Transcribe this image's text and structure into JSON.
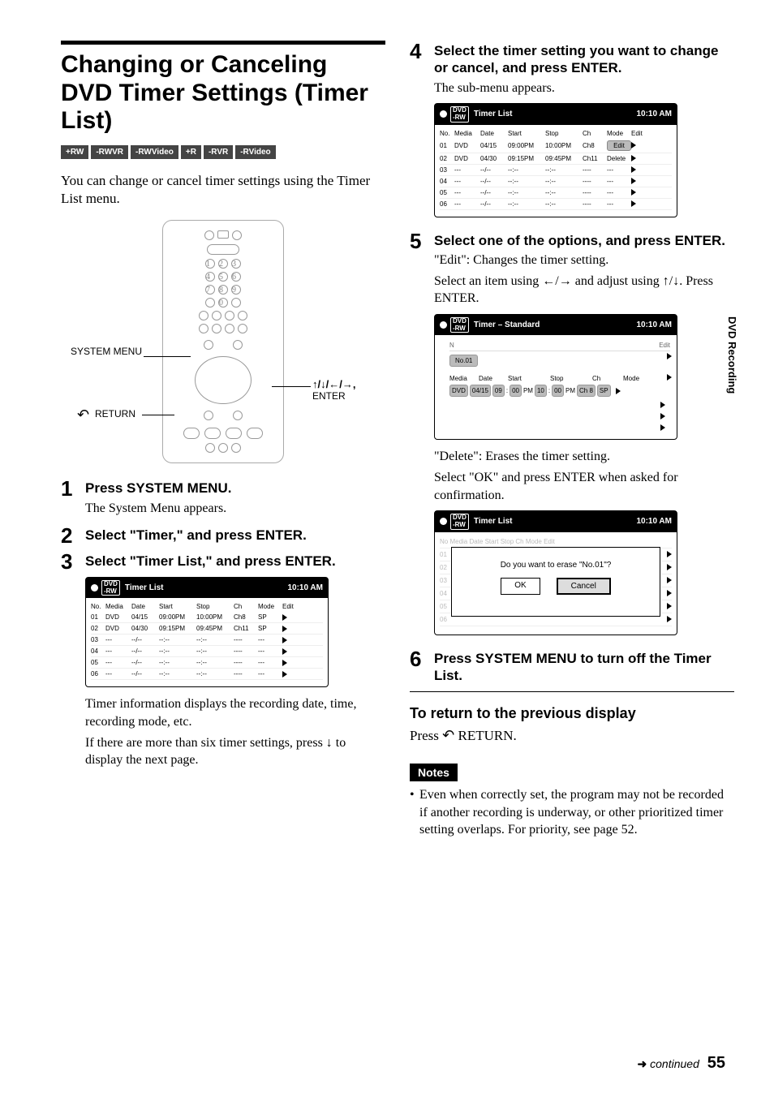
{
  "page_number": "55",
  "continued": "continued",
  "side_tab": "DVD Recording",
  "title": "Changing or Canceling DVD Timer Settings (Timer List)",
  "badges": [
    "+RW",
    "-RWVR",
    "-RWVideo",
    "+R",
    "-RVR",
    "-RVideo"
  ],
  "intro": "You can change or cancel timer settings using the Timer List menu.",
  "remote_labels": {
    "system_menu": "SYSTEM MENU",
    "return": "RETURN",
    "arrows_enter": "↑/↓/←/→, ENTER"
  },
  "steps_left": [
    {
      "num": "1",
      "head": "Press SYSTEM MENU.",
      "sub": "The System Menu appears."
    },
    {
      "num": "2",
      "head": "Select \"Timer,\" and press ENTER."
    },
    {
      "num": "3",
      "head": "Select \"Timer List,\" and press ENTER."
    }
  ],
  "after_screen_left": [
    "Timer information displays the recording date, time, recording mode, etc.",
    "If there are more than six timer settings, press ↓ to display the next page."
  ],
  "screenA": {
    "title": "Timer List",
    "time": "10:10 AM",
    "headers": [
      "No.",
      "Media",
      "Date",
      "Start",
      "Stop",
      "Ch",
      "Mode",
      "Edit"
    ],
    "rows": [
      [
        "01",
        "DVD",
        "04/15",
        "09:00PM",
        "10:00PM",
        "Ch8",
        "SP"
      ],
      [
        "02",
        "DVD",
        "04/30",
        "09:15PM",
        "09:45PM",
        "Ch11",
        "SP"
      ],
      [
        "03",
        "---",
        "--/--",
        "--:--",
        "--:--",
        "----",
        "---"
      ],
      [
        "04",
        "---",
        "--/--",
        "--:--",
        "--:--",
        "----",
        "---"
      ],
      [
        "05",
        "---",
        "--/--",
        "--:--",
        "--:--",
        "----",
        "---"
      ],
      [
        "06",
        "---",
        "--/--",
        "--:--",
        "--:--",
        "----",
        "---"
      ]
    ]
  },
  "steps_right": [
    {
      "num": "4",
      "head": "Select the timer setting you want to change or cancel, and press ENTER.",
      "sub": "The sub-menu appears."
    },
    {
      "num": "5",
      "head": "Select one of the options, and press ENTER.",
      "lines": [
        "\"Edit\": Changes the timer setting.",
        "Select an item using ←/→ and adjust using ↑/↓. Press ENTER."
      ],
      "lines2": [
        "\"Delete\": Erases the timer setting.",
        "Select \"OK\" and press ENTER when asked for confirmation."
      ]
    },
    {
      "num": "6",
      "head": "Press SYSTEM MENU to turn off the Timer List."
    }
  ],
  "screenB": {
    "title": "Timer List",
    "time": "10:10 AM",
    "headers": [
      "No.",
      "Media",
      "Date",
      "Start",
      "Stop",
      "Ch",
      "Mode",
      "Edit"
    ],
    "rows": [
      [
        "01",
        "DVD",
        "04/15",
        "09:00PM",
        "10:00PM",
        "Ch8",
        "Edit"
      ],
      [
        "02",
        "DVD",
        "04/30",
        "09:15PM",
        "09:45PM",
        "Ch11",
        "Delete"
      ],
      [
        "03",
        "---",
        "--/--",
        "--:--",
        "--:--",
        "----",
        "---"
      ],
      [
        "04",
        "---",
        "--/--",
        "--:--",
        "--:--",
        "----",
        "---"
      ],
      [
        "05",
        "---",
        "--/--",
        "--:--",
        "--:--",
        "----",
        "---"
      ],
      [
        "06",
        "---",
        "--/--",
        "--:--",
        "--:--",
        "----",
        "---"
      ]
    ]
  },
  "screenC": {
    "title": "Timer – Standard",
    "time": "10:10 AM",
    "no_label": "No.01",
    "edit_label": "Edit",
    "col_labels": [
      "Media",
      "Date",
      "Start",
      "Stop",
      "Ch",
      "Mode"
    ],
    "cells": [
      "DVD",
      "04/15",
      "09",
      ":",
      "00",
      "PM",
      "10",
      ":",
      "00",
      "PM",
      "Ch 8",
      "SP"
    ]
  },
  "screenD": {
    "title": "Timer List",
    "time": "10:10 AM",
    "bg_rows": [
      "01",
      "02",
      "03",
      "04",
      "05",
      "06"
    ],
    "dialog_text": "Do you want to erase \"No.01\"?",
    "ok": "OK",
    "cancel": "Cancel"
  },
  "return_section": {
    "head": "To return to the previous display",
    "body_prefix": "Press ",
    "body_suffix": " RETURN."
  },
  "notes_label": "Notes",
  "notes": [
    "Even when correctly set, the program may not be recorded if another recording is underway, or other prioritized timer setting overlaps. For priority, see page 52."
  ]
}
